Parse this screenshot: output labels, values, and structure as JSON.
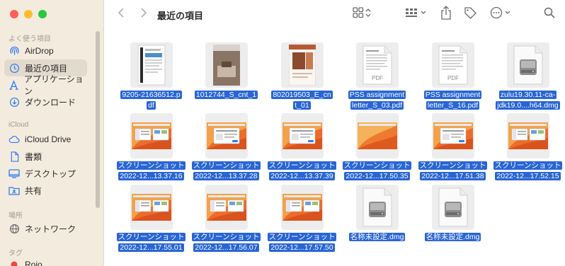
{
  "window": {
    "title": "最近の項目"
  },
  "sidebar": {
    "sections": [
      {
        "title": "よく使う項目",
        "items": [
          {
            "label": "AirDrop",
            "icon": "airdrop-icon"
          },
          {
            "label": "最近の項目",
            "icon": "clock-icon",
            "selected": true
          },
          {
            "label": "アプリケーション",
            "icon": "applications-icon"
          },
          {
            "label": "ダウンロード",
            "icon": "download-icon"
          }
        ]
      },
      {
        "title": "iCloud",
        "items": [
          {
            "label": "iCloud Drive",
            "icon": "cloud-icon"
          },
          {
            "label": "書類",
            "icon": "document-icon"
          },
          {
            "label": "デスクトップ",
            "icon": "desktop-icon"
          },
          {
            "label": "共有",
            "icon": "shared-folder-icon"
          }
        ]
      },
      {
        "title": "場所",
        "items": [
          {
            "label": "ネットワーク",
            "icon": "network-icon"
          }
        ]
      },
      {
        "title": "タグ",
        "items": [
          {
            "label": "Rojo",
            "icon": "red-tag-icon"
          }
        ]
      }
    ]
  },
  "colors": {
    "selection": "#2865d6",
    "tag_red": "#e84b3c",
    "accent": "#2f7bf5"
  },
  "files": [
    {
      "name": "9205-21636512.pdf",
      "lines": [
        "9205-21636512.p",
        "df"
      ],
      "kind": "pdf-doc"
    },
    {
      "name": "1012744_S_cnt_1",
      "lines": [
        "1012744_S_cnt_1"
      ],
      "kind": "photo-brown"
    },
    {
      "name": "802019503_E_cnt_01",
      "lines": [
        "802019503_E_cn",
        "t_01"
      ],
      "kind": "photo-rust"
    },
    {
      "name": "PSS assignment letter_S_03.pdf",
      "lines": [
        "PSS assignment",
        "letter_S_03.pdf"
      ],
      "kind": "pdf-page"
    },
    {
      "name": "PSS assignment letter_S_16.pdf",
      "lines": [
        "PSS assignment",
        "letter_S_16.pdf"
      ],
      "kind": "pdf-page"
    },
    {
      "name": "zulu19.30.11-ca-jdk19.0....h64.dmg",
      "lines": [
        "zulu19.30.11-ca-",
        "jdk19.0....h64.dmg"
      ],
      "kind": "dmg"
    },
    {
      "name": "スクリーンショット 2022-12...13.37.16",
      "lines": [
        "スクリーンショット",
        "2022-12...13.37.16"
      ],
      "kind": "screenshot"
    },
    {
      "name": "スクリーンショット 2022-12...13.37.28",
      "lines": [
        "スクリーンショット",
        "2022-12...13.37.28"
      ],
      "kind": "screenshot-dialog"
    },
    {
      "name": "スクリーンショット 2022-12...13.37.39",
      "lines": [
        "スクリーンショット",
        "2022-12...13.37.39"
      ],
      "kind": "screenshot-dialog"
    },
    {
      "name": "スクリーンショット 2022-12...17.50.35",
      "lines": [
        "スクリーンショット",
        "2022-12...17.50.35"
      ],
      "kind": "screenshot-plain"
    },
    {
      "name": "スクリーンショット 2022-12...17.51.38",
      "lines": [
        "スクリーンショット",
        "2022-12...17.51.38"
      ],
      "kind": "screenshot-dialog"
    },
    {
      "name": "スクリーンショット 2022-12...17.52.15",
      "lines": [
        "スクリーンショット",
        "2022-12...17.52.15"
      ],
      "kind": "screenshot"
    },
    {
      "name": "スクリーンショット 2022-12...17.55.01",
      "lines": [
        "スクリーンショット",
        "2022-12...17.55.01"
      ],
      "kind": "screenshot"
    },
    {
      "name": "スクリーンショット 2022-12...17.56.07",
      "lines": [
        "スクリーンショット",
        "2022-12...17.56.07"
      ],
      "kind": "screenshot"
    },
    {
      "name": "スクリーンショット 2022-12...17.57.50",
      "lines": [
        "スクリーンショット",
        "2022-12...17.57.50"
      ],
      "kind": "screenshot"
    },
    {
      "name": "名称未設定.dmg",
      "lines": [
        "名称未設定.dmg"
      ],
      "kind": "dmg"
    },
    {
      "name": "名称未設定.dmg",
      "lines": [
        "名称未設定.dmg"
      ],
      "kind": "dmg"
    }
  ]
}
